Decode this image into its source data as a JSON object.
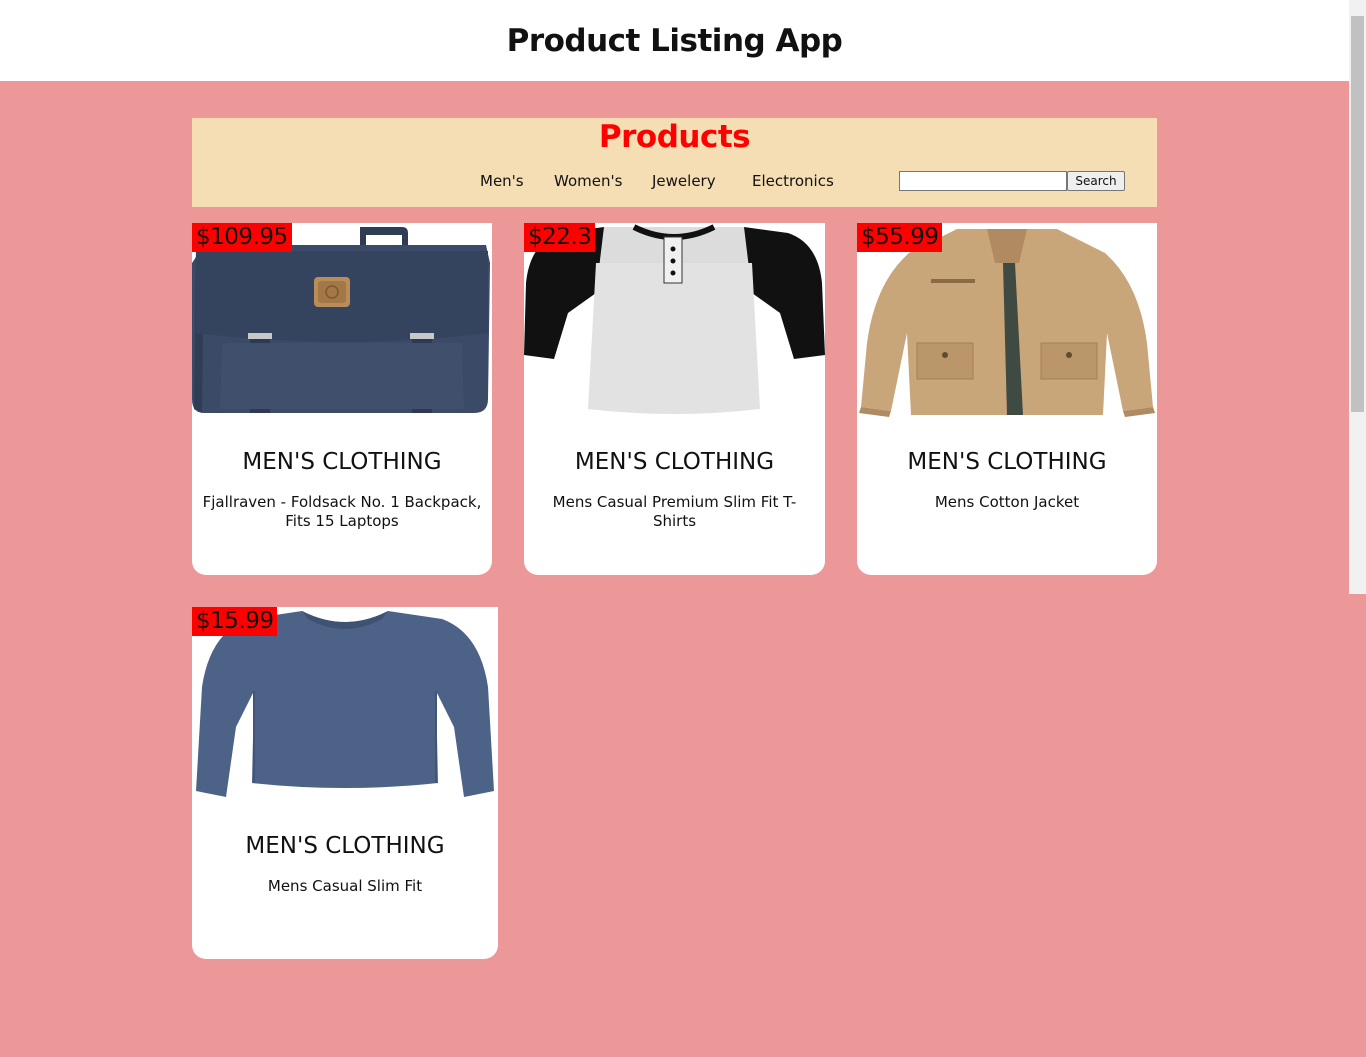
{
  "app": {
    "title": "Product Listing App"
  },
  "banner": {
    "title": "Products",
    "nav": [
      "Men's",
      "Women's",
      "Jewelery",
      "Electronics"
    ],
    "search": {
      "value": "",
      "placeholder": "",
      "button_label": "Search"
    }
  },
  "products": [
    {
      "price": "$109.95",
      "category": "MEN'S CLOTHING",
      "name": "Fjallraven - Foldsack No. 1 Backpack, Fits 15 Laptops",
      "image": "navy-backpack"
    },
    {
      "price": "$22.3",
      "category": "MEN'S CLOTHING",
      "name": "Mens Casual Premium Slim Fit T-Shirts",
      "image": "raglan-henley-tshirt"
    },
    {
      "price": "$55.99",
      "category": "MEN'S CLOTHING",
      "name": "Mens Cotton Jacket",
      "image": "khaki-jacket"
    },
    {
      "price": "$15.99",
      "category": "MEN'S CLOTHING",
      "name": "Mens Casual Slim Fit",
      "image": "blue-long-sleeve-shirt"
    }
  ],
  "colors": {
    "page_background": "#ec9899",
    "banner_background": "#f5deb3",
    "banner_title": "#ff0000",
    "price_tag": "#ff0000",
    "card_background": "#ffffff"
  }
}
